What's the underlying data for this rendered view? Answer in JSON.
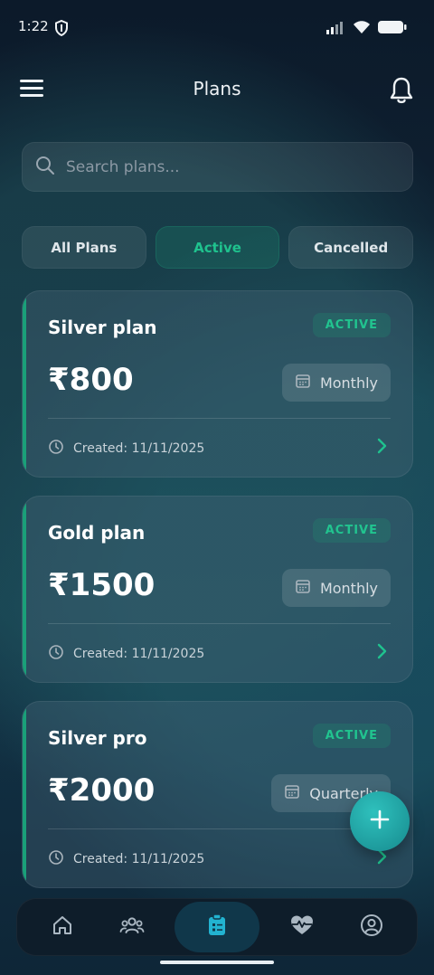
{
  "status_bar": {
    "time": "1:22"
  },
  "header": {
    "title": "Plans"
  },
  "search": {
    "placeholder": "Search plans..."
  },
  "tabs": [
    {
      "label": "All Plans"
    },
    {
      "label": "Active"
    },
    {
      "label": "Cancelled"
    }
  ],
  "plans": [
    {
      "name": "Silver plan",
      "status": "ACTIVE",
      "price": "₹800",
      "cycle": "Monthly",
      "created": "Created: 11/11/2025"
    },
    {
      "name": "Gold plan",
      "status": "ACTIVE",
      "price": "₹1500",
      "cycle": "Monthly",
      "created": "Created: 11/11/2025"
    },
    {
      "name": "Silver pro",
      "status": "ACTIVE",
      "price": "₹2000",
      "cycle": "Quarterly",
      "created": "Created: 11/11/2025"
    }
  ],
  "nav": [
    {
      "icon": "home-icon"
    },
    {
      "icon": "users-icon"
    },
    {
      "icon": "clipboard-icon"
    },
    {
      "icon": "heart-pulse-icon"
    },
    {
      "icon": "profile-icon"
    }
  ],
  "colors": {
    "accent": "#1fc28e",
    "fab": "#22a7a7",
    "background": "#0f2233"
  }
}
